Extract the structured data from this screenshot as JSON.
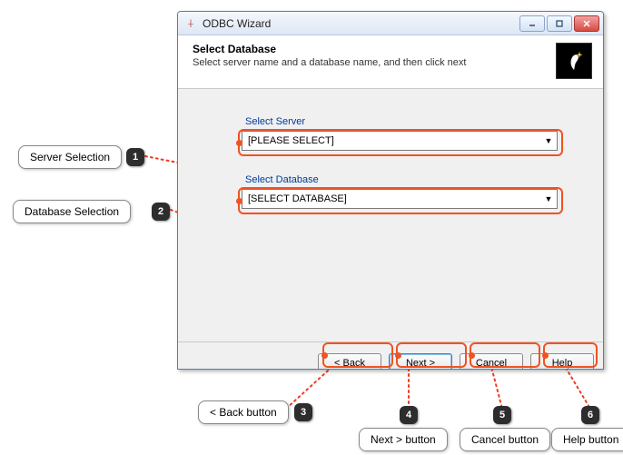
{
  "window": {
    "title": "ODBC Wizard",
    "header_title": "Select Database",
    "header_subtitle": "Select  server name and a database name, and then click next"
  },
  "fields": {
    "server_label": "Select Server",
    "server_value": "[PLEASE SELECT]",
    "database_label": "Select Database",
    "database_value": "[SELECT DATABASE]"
  },
  "buttons": {
    "back": "< Back",
    "next": "Next >",
    "cancel": "Cancel",
    "help": "Help"
  },
  "callouts": {
    "c1": {
      "num": "1",
      "text": "Server Selection"
    },
    "c2": {
      "num": "2",
      "text": "Database Selection"
    },
    "c3": {
      "num": "3",
      "text": "< Back button"
    },
    "c4": {
      "num": "4",
      "text": "Next > button"
    },
    "c5": {
      "num": "5",
      "text": "Cancel button"
    },
    "c6": {
      "num": "6",
      "text": "Help button"
    }
  }
}
